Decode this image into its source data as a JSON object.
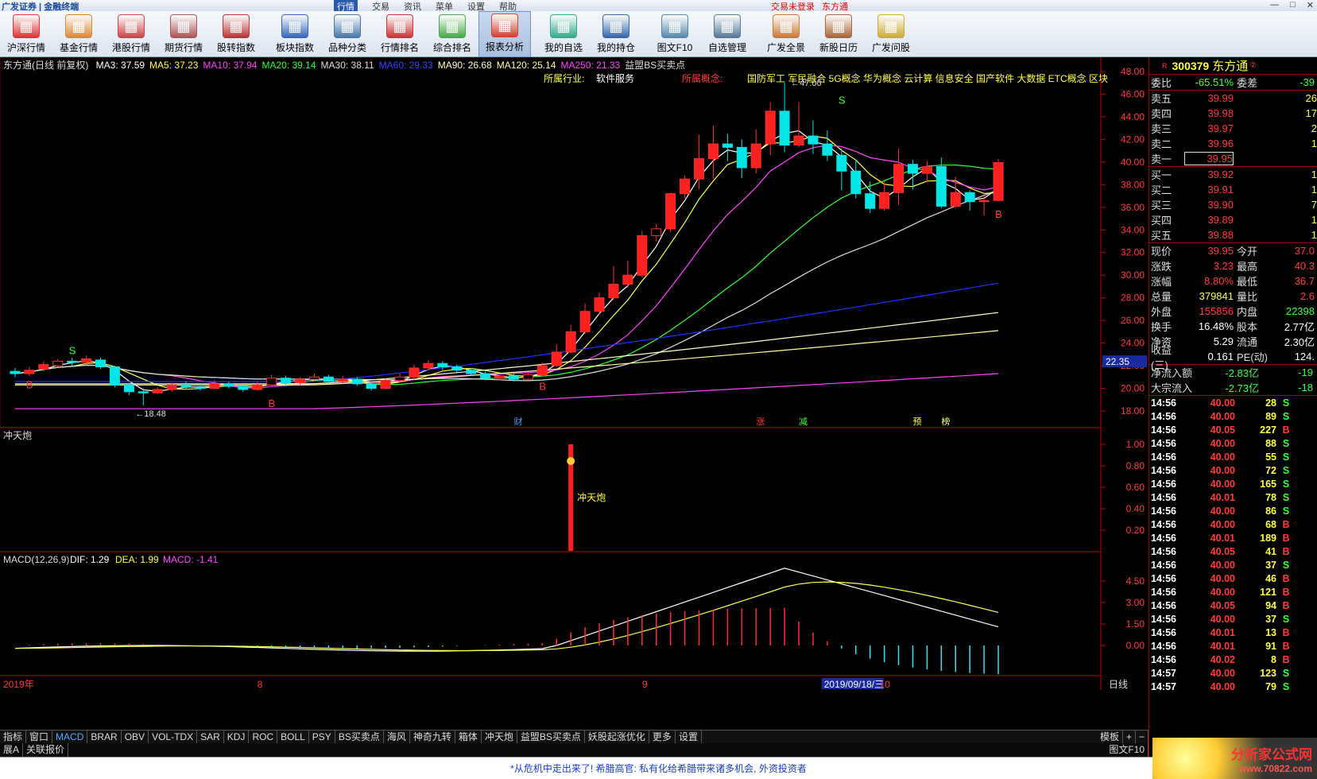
{
  "titlebar": {
    "brand": "广发证券 | 金融终端",
    "menu": [
      "行情",
      "交易",
      "资讯",
      "菜单",
      "设置",
      "帮助"
    ],
    "login_status": "交易未登录",
    "stock_name_top": "东方通",
    "window_controls": [
      "—",
      "□",
      "✕"
    ]
  },
  "toolbar": [
    {
      "label": "沪深行情",
      "icon": "quote-icon",
      "color": "#d33"
    },
    {
      "label": "基金行情",
      "icon": "fund-icon",
      "color": "#d83"
    },
    {
      "label": "港股行情",
      "icon": "hk-icon",
      "color": "#c44"
    },
    {
      "label": "期货行情",
      "icon": "futures-icon",
      "color": "#a55"
    },
    {
      "label": "股转指数",
      "icon": "index-icon",
      "color": "#b33"
    },
    {
      "label": "板块指数",
      "icon": "sector-icon",
      "color": "#36b"
    },
    {
      "label": "品种分类",
      "icon": "category-icon",
      "color": "#47a"
    },
    {
      "label": "行情排名",
      "icon": "rank-icon",
      "color": "#c33"
    },
    {
      "label": "综合排名",
      "icon": "overall-rank-icon",
      "color": "#4a4"
    },
    {
      "label": "报表分析",
      "icon": "report-icon",
      "color": "#c43"
    },
    {
      "label": "我的自选",
      "icon": "watchlist-icon",
      "color": "#3a8"
    },
    {
      "label": "我的持仓",
      "icon": "position-icon",
      "color": "#36a"
    },
    {
      "label": "图文F10",
      "icon": "f10-icon",
      "color": "#58a"
    },
    {
      "label": "自选管理",
      "icon": "manage-icon",
      "color": "#579"
    },
    {
      "label": "广发全景",
      "icon": "panorama-icon",
      "color": "#c73"
    },
    {
      "label": "新股日历",
      "icon": "calendar-icon",
      "color": "#a63"
    },
    {
      "label": "广发问股",
      "icon": "ask-icon",
      "color": "#ca3"
    }
  ],
  "chart_header": {
    "name": "东方通(日线 前复权)",
    "ma": [
      {
        "label": "MA3: 37.59",
        "color": "#ffffff"
      },
      {
        "label": "MA5: 37.23",
        "color": "#ffff4d"
      },
      {
        "label": "MA10: 37.94",
        "color": "#ff44ff"
      },
      {
        "label": "MA20: 39.14",
        "color": "#33ff33"
      },
      {
        "label": "MA30: 38.11",
        "color": "#dddddd"
      },
      {
        "label": "MA60: 29.33",
        "color": "#3344ff"
      },
      {
        "label": "MA90: 26.68",
        "color": "#ffffcc"
      },
      {
        "label": "MA120: 25.14",
        "color": "#ffff99"
      },
      {
        "label": "MA250: 21.33",
        "color": "#ff44ff"
      },
      {
        "label": "益盟BS买卖点",
        "color": "#dddddd"
      }
    ],
    "industry_label": "所属行业:",
    "industry": "软件服务",
    "concept_label": "所属概念:",
    "concepts": "国防军工 军民融合 5G概念 华为概念 云计算 信息安全 国产软件 大数据 ETC概念 区块",
    "max_label": "47.00",
    "min_label": "18.48",
    "price_tag": "22.35",
    "event_labels": [
      "财",
      "涨",
      "减",
      "预",
      "榜"
    ]
  },
  "price_axis": [
    "48.00",
    "46.00",
    "44.00",
    "42.00",
    "40.00",
    "38.00",
    "36.00",
    "34.00",
    "32.00",
    "30.00",
    "28.00",
    "26.00",
    "24.00",
    "22.00",
    "20.00",
    "18.00"
  ],
  "indicator1": {
    "title": "冲天炮",
    "signal_label": "冲天炮",
    "axis": [
      "1.00",
      "0.80",
      "0.60",
      "0.40",
      "0.20"
    ]
  },
  "macd": {
    "title": "MACD(12,26,9)",
    "dif": "DIF: 1.29",
    "dea": "DEA: 1.99",
    "macd": "MACD: -1.41",
    "axis": [
      "4.50",
      "3.00",
      "1.50",
      "0.00"
    ]
  },
  "date_axis": {
    "labels": [
      "2019年",
      "8",
      "9",
      "2019/09/18/三",
      "10"
    ],
    "mode": "日线"
  },
  "tabs": [
    "指标",
    "窗口",
    "MACD",
    "BRAR",
    "OBV",
    "VOL-TDX",
    "SAR",
    "KDJ",
    "ROC",
    "BOLL",
    "PSY",
    "BS买卖点",
    "海风",
    "神奇九转",
    "箱体",
    "冲天炮",
    "益盟BS买卖点",
    "妖股起涨优化",
    "更多",
    "设置"
  ],
  "tab_active": "MACD",
  "tab_right": [
    "模板",
    "+",
    "−"
  ],
  "tabs2": [
    "展A",
    "关联报价"
  ],
  "tabs2_right": "图文F10",
  "quote": {
    "code": "300379",
    "name": "东方通",
    "weibi_label": "委比",
    "weibi": "-65.51%",
    "weicha_label": "委差",
    "weicha": "-39",
    "asks": [
      {
        "label": "卖五",
        "price": "39.99",
        "vol": "26"
      },
      {
        "label": "卖四",
        "price": "39.98",
        "vol": "17"
      },
      {
        "label": "卖三",
        "price": "39.97",
        "vol": "2"
      },
      {
        "label": "卖二",
        "price": "39.96",
        "vol": "1"
      },
      {
        "label": "卖一",
        "price": "39.95",
        "vol": ""
      }
    ],
    "bids": [
      {
        "label": "买一",
        "price": "39.92",
        "vol": "1"
      },
      {
        "label": "买二",
        "price": "39.91",
        "vol": "1"
      },
      {
        "label": "买三",
        "price": "39.90",
        "vol": "7"
      },
      {
        "label": "买四",
        "price": "39.89",
        "vol": "1"
      },
      {
        "label": "买五",
        "price": "39.88",
        "vol": "1"
      }
    ],
    "stats": [
      {
        "l1": "现价",
        "v1": "39.95",
        "c1": "red",
        "l2": "今开",
        "v2": "37.0",
        "c2": "red"
      },
      {
        "l1": "涨跌",
        "v1": "3.23",
        "c1": "red",
        "l2": "最高",
        "v2": "40.3",
        "c2": "red"
      },
      {
        "l1": "涨幅",
        "v1": "8.80%",
        "c1": "red",
        "l2": "最低",
        "v2": "36.7",
        "c2": "red"
      },
      {
        "l1": "总量",
        "v1": "379841",
        "c1": "yel",
        "l2": "量比",
        "v2": "2.6",
        "c2": "red"
      },
      {
        "l1": "外盘",
        "v1": "155856",
        "c1": "red",
        "l2": "内盘",
        "v2": "22398",
        "c2": "grn"
      },
      {
        "l1": "换手",
        "v1": "16.48%",
        "c1": "wht",
        "l2": "股本",
        "v2": "2.77亿",
        "c2": "wht"
      },
      {
        "l1": "净资",
        "v1": "5.29",
        "c1": "wht",
        "l2": "流通",
        "v2": "2.30亿",
        "c2": "wht"
      },
      {
        "l1": "收益(三)",
        "v1": "0.161",
        "c1": "wht",
        "l2": "PE(动)",
        "v2": "124.",
        "c2": "wht"
      }
    ],
    "flows": [
      {
        "label": "净流入额",
        "v1": "-2.83亿",
        "v2": "-19"
      },
      {
        "label": "大宗流入",
        "v1": "-2.73亿",
        "v2": "-18"
      }
    ],
    "ticks": [
      {
        "t": "14:56",
        "p": "40.00",
        "v": "28",
        "bs": "S"
      },
      {
        "t": "14:56",
        "p": "40.00",
        "v": "89",
        "bs": "S"
      },
      {
        "t": "14:56",
        "p": "40.05",
        "v": "227",
        "bs": "B"
      },
      {
        "t": "14:56",
        "p": "40.00",
        "v": "88",
        "bs": "S"
      },
      {
        "t": "14:56",
        "p": "40.00",
        "v": "55",
        "bs": "S"
      },
      {
        "t": "14:56",
        "p": "40.00",
        "v": "72",
        "bs": "S"
      },
      {
        "t": "14:56",
        "p": "40.00",
        "v": "165",
        "bs": "S"
      },
      {
        "t": "14:56",
        "p": "40.01",
        "v": "78",
        "bs": "S"
      },
      {
        "t": "14:56",
        "p": "40.00",
        "v": "86",
        "bs": "S"
      },
      {
        "t": "14:56",
        "p": "40.00",
        "v": "68",
        "bs": "B"
      },
      {
        "t": "14:56",
        "p": "40.01",
        "v": "189",
        "bs": "B"
      },
      {
        "t": "14:56",
        "p": "40.05",
        "v": "41",
        "bs": "B"
      },
      {
        "t": "14:56",
        "p": "40.00",
        "v": "37",
        "bs": "S"
      },
      {
        "t": "14:56",
        "p": "40.00",
        "v": "46",
        "bs": "B"
      },
      {
        "t": "14:56",
        "p": "40.00",
        "v": "121",
        "bs": "B"
      },
      {
        "t": "14:56",
        "p": "40.05",
        "v": "94",
        "bs": "B"
      },
      {
        "t": "14:56",
        "p": "40.00",
        "v": "37",
        "bs": "S"
      },
      {
        "t": "14:56",
        "p": "40.01",
        "v": "13",
        "bs": "B"
      },
      {
        "t": "14:56",
        "p": "40.01",
        "v": "91",
        "bs": "B"
      },
      {
        "t": "14:56",
        "p": "40.02",
        "v": "8",
        "bs": "B"
      },
      {
        "t": "14:57",
        "p": "40.00",
        "v": "123",
        "bs": "S"
      },
      {
        "t": "14:57",
        "p": "40.00",
        "v": "79",
        "bs": "S"
      }
    ]
  },
  "statusbar": "*从危机中走出来了! 希腊高官: 私有化给希腊带来诸多机会, 外资投资者",
  "watermark": {
    "line1": "分析家公式网",
    "line2": "www.70822.com"
  },
  "colors": {
    "up": "#ff3030",
    "down": "#00e5e5",
    "grid": "#800000",
    "accent": "#ff3c3c"
  }
}
